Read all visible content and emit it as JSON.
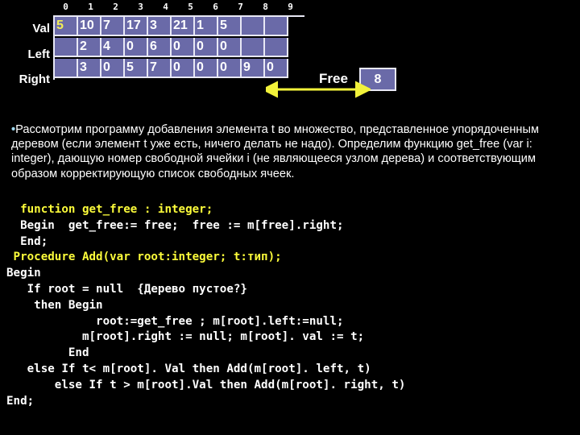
{
  "array_table": {
    "column_headers": [
      "0",
      "1",
      "2",
      "3",
      "4",
      "5",
      "6",
      "7",
      "8",
      "9"
    ],
    "rows": [
      {
        "label": "Val",
        "name": "row-val",
        "cells": [
          {
            "value": "5",
            "highlight": true
          },
          {
            "value": "10",
            "highlight": false
          },
          {
            "value": "7",
            "highlight": false
          },
          {
            "value": "17",
            "highlight": false
          },
          {
            "value": "3",
            "highlight": false
          },
          {
            "value": "21",
            "highlight": false
          },
          {
            "value": "1",
            "highlight": false
          },
          {
            "value": "5",
            "highlight": false
          },
          {
            "value": "",
            "highlight": false
          },
          {
            "value": "",
            "highlight": false
          }
        ]
      },
      {
        "label": "Left",
        "name": "row-left",
        "cells": [
          {
            "value": "",
            "highlight": false
          },
          {
            "value": "2",
            "highlight": false
          },
          {
            "value": "4",
            "highlight": false
          },
          {
            "value": "0",
            "highlight": false
          },
          {
            "value": "6",
            "highlight": false
          },
          {
            "value": "0",
            "highlight": false
          },
          {
            "value": "0",
            "highlight": false
          },
          {
            "value": "0",
            "highlight": false
          },
          {
            "value": "",
            "highlight": false
          },
          {
            "value": "",
            "highlight": false
          }
        ]
      },
      {
        "label": "Right",
        "name": "row-right",
        "cells": [
          {
            "value": "",
            "highlight": false
          },
          {
            "value": "3",
            "highlight": false
          },
          {
            "value": "0",
            "highlight": false
          },
          {
            "value": "5",
            "highlight": false
          },
          {
            "value": "7",
            "highlight": false
          },
          {
            "value": "0",
            "highlight": false
          },
          {
            "value": "0",
            "highlight": false
          },
          {
            "value": "0",
            "highlight": false
          },
          {
            "value": "9",
            "highlight": false
          },
          {
            "value": "0",
            "highlight": false
          }
        ]
      }
    ],
    "cell_fill_color": "#6a6aa8",
    "cell_border_color": "#e8e8f5",
    "highlight_color": "#f2ee57"
  },
  "free_pointer": {
    "label": "Free",
    "value": "8",
    "arrow_color": "#f2f23a",
    "arrow_name": "free-list-double-arrow"
  },
  "intro": {
    "bullet": "•",
    "text": "Рассмотрим программу добавления элемента t во множество, представленное упорядоченным деревом (если элемент t уже есть, ничего делать не надо). Определим функцию get_free (var i: integer), дающую номер свободной ячейки i (не являющееся узлом дерева) и соответствующим образом корректирующую список свободных ячеек.",
    "bullet_color": "#9fd8ef"
  },
  "code": {
    "keyword_color": "#fbfb3a",
    "text_color": "#ffffff",
    "lines": [
      {
        "text": "  function get_free : integer;",
        "style": "kw"
      },
      {
        "text": "  Begin  get_free:= free;  free := m[free].right;",
        "style": "plain"
      },
      {
        "text": "  End;",
        "style": "plain"
      },
      {
        "text": " Procedure Add(var root:integer; t:тип);",
        "style": "kw"
      },
      {
        "text": "Begin",
        "style": "plain"
      },
      {
        "text": "   If root = null  {Дерево пустое?}",
        "style": "plain"
      },
      {
        "text": "    then Begin",
        "style": "plain"
      },
      {
        "text": "             root:=get_free ; m[root].left:=null;",
        "style": "plain"
      },
      {
        "text": "           m[root].right := null; m[root]. val := t;",
        "style": "plain"
      },
      {
        "text": "         End",
        "style": "plain"
      },
      {
        "text": "   else If t< m[root]. Val then Add(m[root]. left, t)",
        "style": "plain"
      },
      {
        "text": "       else If t > m[root].Val then Add(m[root]. right, t)",
        "style": "plain"
      },
      {
        "text": "End;",
        "style": "plain"
      }
    ]
  }
}
